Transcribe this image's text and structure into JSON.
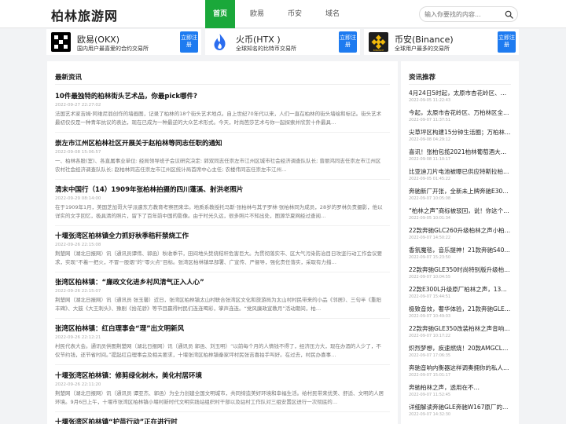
{
  "header": {
    "logo": "柏林旅游网",
    "nav": [
      "首页",
      "欧易",
      "币安",
      "域名"
    ],
    "search_placeholder": "输入你要找的内容..."
  },
  "exchanges": [
    {
      "name": "欧易(OKX)",
      "desc": "国内用户最喜爱的合约交易所",
      "button": "立即注册",
      "logo_color": "#000000",
      "logo_icon": "okx-logo-icon"
    },
    {
      "name": "火币(HTX )",
      "desc": "全球知名的比特币交易所",
      "button": "立即注册",
      "logo_color": "#2b6def",
      "logo_icon": "htx-flame-logo-icon"
    },
    {
      "name": "币安(Binance)",
      "desc": "全球用户最多的交易所",
      "button": "立即注册",
      "logo_color": "#1e1e1e",
      "logo_icon": "binance-logo-icon"
    }
  ],
  "main": {
    "title": "最新资讯",
    "articles": [
      {
        "title": "10件最独特的柏林街头艺术品，你最pick哪件?",
        "date": "2022-09-27 22:27:02",
        "summary": "法国艺术家吉姆·阿维尼翁创作的墙画图，记录了柏林的18个街头艺术地点。自上世纪70年代以来，人们一直在柏林的街头墙绘和标记。街头艺术最初仅仅是一种青年抗议的表达，现在已成为一种最逆的大众艺术形式。今天，时尚芭莎艺术与你一起探索并欣赏十件最具…"
      },
      {
        "title": "崇左市江州区柏林社区开展关于赵柏林等同志任职的通知",
        "date": "2022-09-08 15:06:57",
        "summary": "一、柏林各股(室)、各直属事业单位:      经局领导班子会议研究决定:      郭双同志任崇左市江州区城市社会经济调查队队长;      曾丽鸿同志任崇左市江州区农村社会经济调查队队长;      赵柏林同志任崇左市江州区统计局首席中心主任;      农楼伟同志任崇左市江州…"
      },
      {
        "title": "清末中国行（14）1909年张柏林拍摄的四川蓬溪、射洪老照片",
        "date": "2022-09-29 08:14:00",
        "summary": "在于1909年1月，美国芝加哥大学派遣东方教育考察团来华。地质系教授托马斯·张柏林与其子罗林·张柏林同为成员，28岁的罗林负责摄影，他以详实的文字回忆，极具清的照片，留下了百年前中国的影像。由于时光久远，很多照片不知出处，图源华夏网经过查阅…"
      },
      {
        "title": "十堰张湾区柏林镇全力抓好秋季秸秆禁烧工作",
        "date": "2022-09-26 22:15:08",
        "summary": "荆楚网（湖北日报网）讯（通讯员谭伟、郭函）秋收季节，田间地头焚烧秸秆危害巨大。为贯彻落实市、区大气污染防治目日攻坚行动工作会议要求，实现“不着一把火，不冒一股烟”的“零火点”目标。张湾区柏林镇早部署、广宣传、严督导，强化责任落实，采取有力措…"
      },
      {
        "title": "张湾区柏林镇：“廉政文化进乡村风清气正入人心”",
        "date": "2022-09-26 22:15:07",
        "summary": "荆楚网（湖北日报网）讯（通讯员 张玉馨）近日，张湾区柏林镇太山村联合张湾区文化和旅游局为太山村村民带来的小品《邻居》、三句半《重阳丰碑》、大鼓《大王刺头》、豫剧《拾花骄》等节目赢得村民们连连喝彩，掌声连连。“党风廉政宣教月”活动期间，柏…"
      },
      {
        "title": "张湾区柏林镇：红白理事会“理”出文明新风",
        "date": "2022-09-26 22:12:21",
        "summary": "村民代表大会。通讯员供图荆楚网（湖北日报网）讯（通讯员 郭函、刘玉明）“以前每个月的人情钱不得了，经济压力大，现在办酒的人少了，不仅节约钱，还节省时间。”提起红白理事会及相关要求，十堰张湾区柏林镇秦家坪村民张吉喜拍手叫好。在过去，村民办喜事…"
      },
      {
        "title": "十堰张湾区柏林镇：修剪绿化树木，美化村居环境",
        "date": "2022-09-26 22:11:20",
        "summary": "荆楚网（湖北日报网）讯（通讯员 谭亚杰、郭函）为全力创建全国文明城市，共同缔造美好环境和幸福生活。给村民带来优美、舒适、文明的人居环境。9月6日上午，十堰市张湾区柏林镇小堰村新时代文明实践站组织村干部以及驻村工作队对三组安置区进行一次彻底的…"
      },
      {
        "title": "十堰张湾区柏林镇“护苗行动”正在进行时",
        "date": "",
        "summary": ""
      }
    ]
  },
  "sidebar": {
    "title": "资讯推荐",
    "items": [
      {
        "title": "4月24日5时起，太原市杏花岭区、万柏…",
        "date": "2022-09-05 11:22:43"
      },
      {
        "title": "今起，太原市杏花岭区、万柏林区全员…",
        "date": "2022-09-07 11:37:51"
      },
      {
        "title": "尖草坪区构建15分钟生活圈；万柏林推…",
        "date": "2022-09-08 04:29:12"
      },
      {
        "title": "喜讯！张柏包揽2021柏林葡萄酒大赛中…",
        "date": "2022-09-08 11:10:17"
      },
      {
        "title": "比亚迪刀片电池被曝已供应特斯拉柏林…",
        "date": "2022-09-05 01:45:22"
      },
      {
        "title": "奔驰新厂开张，全新未上牌奔驰E300L…",
        "date": "2022-09-07 10:05:08"
      },
      {
        "title": "“柏林之声”商标被驳回，说！你这个嗯…",
        "date": "2022-09-05 10:01:34"
      },
      {
        "title": "22款奔驰GLC260升级柏林之声小柏林…",
        "date": "2022-09-07 14:50:22"
      },
      {
        "title": "香氛魔毯，音乐提神！21款奔驰S400L…",
        "date": "2022-09-07 15:23:50"
      },
      {
        "title": "22款奔驰GLE350时尚特别版升级柏林…",
        "date": "2022-09-07 10:04:55"
      },
      {
        "title": "22款E300L升级原厂柏林之声，13个喇…",
        "date": "2022-09-07 15:44:51"
      },
      {
        "title": "极致音效，奢华体验，21款奔驰GLE升…",
        "date": "2022-09-07 10:49:03"
      },
      {
        "title": "22款奔驰GLE350改装柏林之声音响…",
        "date": "2022-09-07 10:17:22"
      },
      {
        "title": "炽烈梦想，疾速燃烧！20款AMGCLA45…",
        "date": "2022-09-07 17:06:35"
      },
      {
        "title": "奔驰音响内衡器这样调奏拥你的私人音…",
        "date": "2022-09-07 15:01:17"
      },
      {
        "title": "奔驰柏林之声，透用在不…",
        "date": "2022-09-07 11:52:45"
      },
      {
        "title": "详细解读奔驰GLE奔驰W167原厂的大…",
        "date": "2022-09-07 14:32:30"
      }
    ]
  }
}
